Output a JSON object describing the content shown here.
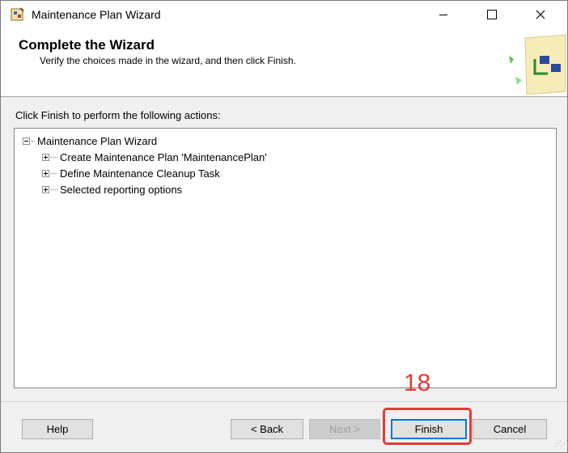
{
  "window": {
    "title": "Maintenance Plan Wizard",
    "minimize_icon": "minimize-icon",
    "maximize_icon": "maximize-icon",
    "close_icon": "close-icon"
  },
  "header": {
    "title": "Complete the Wizard",
    "subtitle": "Verify the choices made in the wizard, and then click Finish."
  },
  "instructions": "Click Finish to perform the following actions:",
  "tree": {
    "root": "Maintenance Plan Wizard",
    "children": [
      "Create Maintenance Plan 'MaintenancePlan'",
      "Define Maintenance Cleanup Task",
      "Selected reporting options"
    ]
  },
  "buttons": {
    "help": "Help",
    "back_prefix": "< ",
    "back": "Back",
    "next": "Next",
    "next_suffix": " >",
    "finish": "Finish",
    "cancel": "Cancel"
  },
  "annotation": {
    "step": "18",
    "color": "#e53935"
  },
  "colors": {
    "default_button_border": "#0078d7"
  }
}
